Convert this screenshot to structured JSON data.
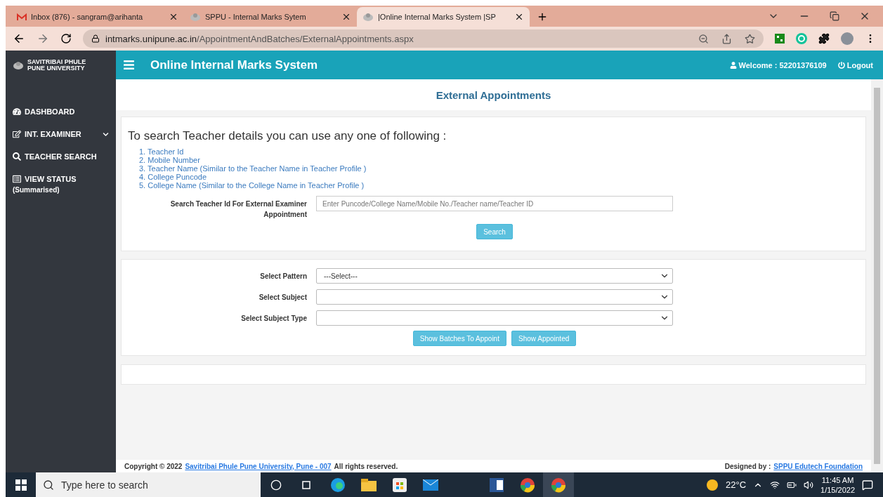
{
  "browser": {
    "tabs": [
      {
        "title": "Inbox (876) - sangram@arihanta",
        "selected": false
      },
      {
        "title": "SPPU - Internal Marks Sytem",
        "selected": false
      },
      {
        "title": "|Online Internal Marks System |SP",
        "selected": true
      }
    ],
    "url": {
      "host": "intmarks.unipune.ac.in",
      "path": "/AppointmentAndBatches/ExternalAppointments.aspx"
    }
  },
  "app": {
    "brand": [
      "SAVITRIBAI PHULE",
      "PUNE UNIVERSITY"
    ],
    "title": "Online Internal Marks System",
    "welcome": "Welcome : 52201376109",
    "logout": "Logout"
  },
  "sidebar": {
    "items": [
      {
        "label": "DASHBOARD",
        "expandable": false
      },
      {
        "label": "INT. EXAMINER",
        "expandable": true
      },
      {
        "label": "TEACHER SEARCH",
        "expandable": false
      },
      {
        "label": "VIEW STATUS",
        "sublabel": "(Summarised)",
        "expandable": false
      }
    ]
  },
  "page_title": "External Appointments",
  "search_panel": {
    "heading": "To search Teacher details you can use any one of following :",
    "options": [
      "1. Teacher Id",
      "2. Mobile Number",
      "3. Teacher Name (Similar to the Teacher Name in Teacher Profile )",
      "4. College Puncode",
      "5. College Name (Similar to the College Name in Teacher Profile )"
    ],
    "field_label": "Search Teacher Id For External Examiner Appointment",
    "placeholder": "Enter Puncode/College Name/Mobile No./Teacher name/Teacher ID",
    "button": "Search"
  },
  "select_panel": {
    "fields": [
      {
        "label": "Select Pattern",
        "value": "---Select---"
      },
      {
        "label": "Select Subject"
      },
      {
        "label": "Select Subject Type"
      }
    ],
    "buttons": [
      "Show Batches To Appoint",
      "Show Appointed"
    ]
  },
  "footer": {
    "copyright": "Copyright © 2022",
    "university_link": "Savitribai Phule Pune University, Pune - 007",
    "rights": "All rights reserved.",
    "designed_by": "Designed by :",
    "foundation_link": "SPPU Edutech Foundation"
  },
  "taskbar": {
    "search_placeholder": "Type here to search",
    "temperature": "22°C",
    "time": "11:45 AM",
    "date": "1/15/2022"
  }
}
